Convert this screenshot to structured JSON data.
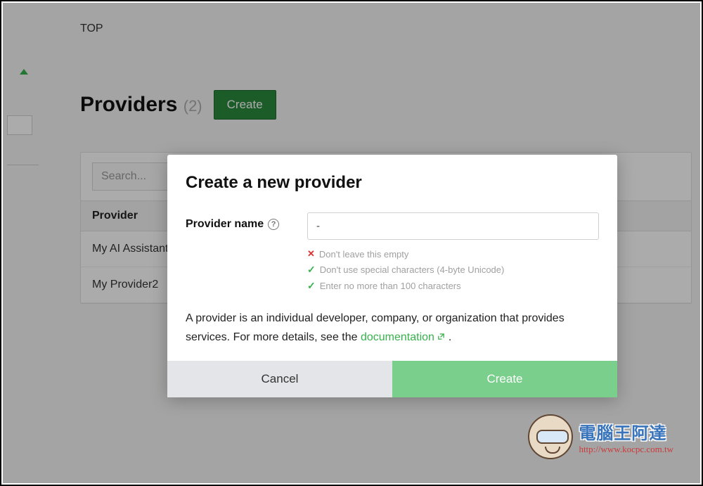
{
  "breadcrumb": "TOP",
  "heading": {
    "title": "Providers",
    "count": "(2)",
    "create_label": "Create"
  },
  "search": {
    "placeholder": "Search..."
  },
  "table": {
    "header": "Provider",
    "rows": [
      "My AI Assistant",
      "My Provider2"
    ]
  },
  "modal": {
    "title": "Create a new provider",
    "field_label": "Provider name",
    "input_value": "-",
    "hints": {
      "empty": "Don't leave this empty",
      "special": "Don't use special characters (4-byte Unicode)",
      "length": "Enter no more than 100 characters"
    },
    "description_prefix": "A provider is an individual developer, company, or organization that provides services. For more details, see the ",
    "description_link": "documentation",
    "description_suffix": " .",
    "cancel_label": "Cancel",
    "submit_label": "Create"
  },
  "watermark": {
    "cn": "電腦王阿達",
    "url": "http://www.kocpc.com.tw"
  }
}
